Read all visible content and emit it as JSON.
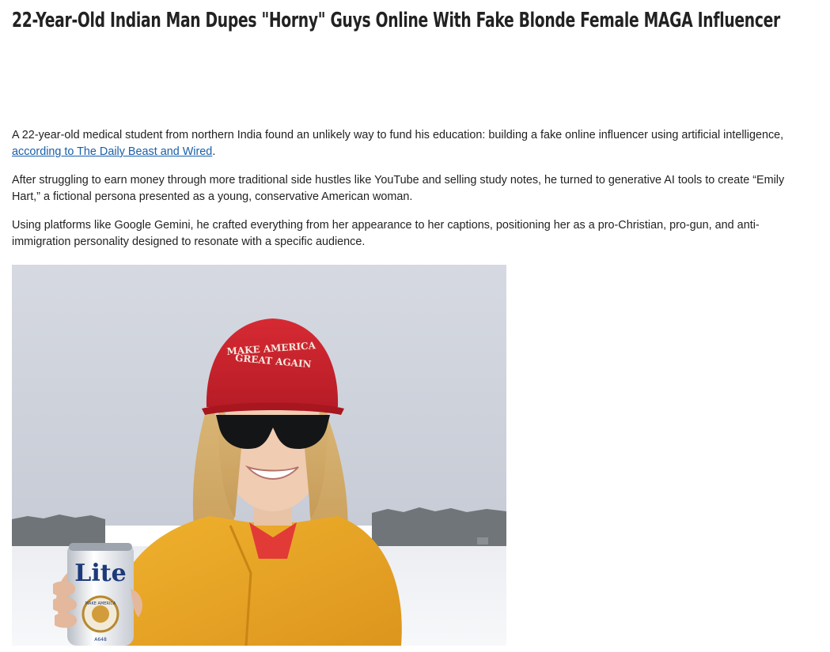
{
  "article": {
    "headline": "22-Year-Old Indian Man Dupes \"Horny\" Guys Online With Fake Blonde Female MAGA Influencer",
    "paragraphs": [
      {
        "before": "A 22-year-old medical student from northern India found an unlikely way to fund his education: building a fake online influencer using artificial intelligence, ",
        "link": "according to The Daily Beast and Wired",
        "after": "."
      },
      {
        "before": "After struggling to earn money through more traditional side hustles like YouTube and selling study notes, he turned to generative AI tools to create “Emily Hart,” a fictional persona presented as a young, conservative American woman.",
        "link": "",
        "after": ""
      },
      {
        "before": "Using platforms like Google Gemini, he crafted everything from her appearance to her captions, positioning her as a pro-Christian, pro-gun, and anti-immigration personality designed to resonate with a specific audience.",
        "link": "",
        "after": ""
      }
    ]
  },
  "photo": {
    "hat_line1": "MAKE AMERICA",
    "hat_line2": "GREAT AGAIN",
    "can_brand": "Lite",
    "can_badge": "MAKE AMERICA",
    "can_small": "A648"
  },
  "colors": {
    "link": "#1a5fa8",
    "text": "#222222",
    "hat_red": "#c8202a",
    "jacket_yellow": "#e9a424"
  }
}
